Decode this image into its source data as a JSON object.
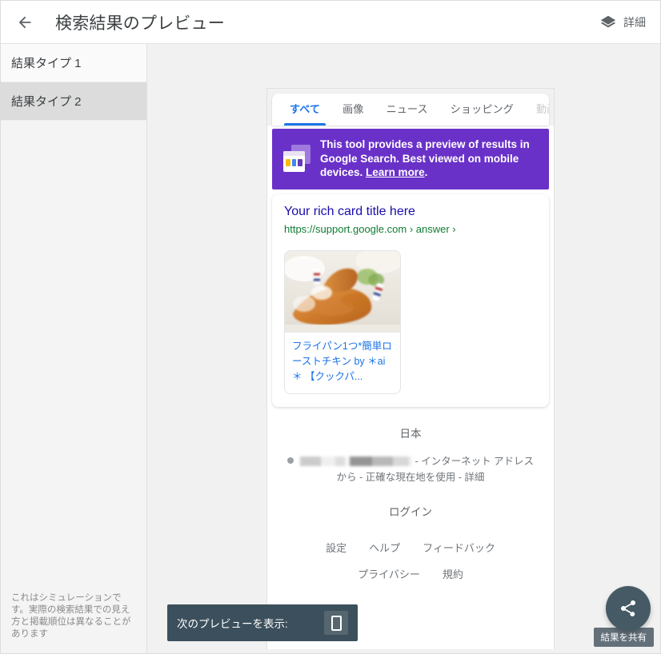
{
  "header": {
    "back_icon": "arrow-left-icon",
    "title": "検索結果のプレビュー",
    "details_icon": "layers-icon",
    "details_label": "詳細"
  },
  "sidebar": {
    "items": [
      {
        "label": "結果タイプ 1",
        "selected": false
      },
      {
        "label": "結果タイプ 2",
        "selected": true
      }
    ],
    "note": "これはシミュレーションです。実際の検索結果での見え方と掲載順位は異なることがあります"
  },
  "preview": {
    "tabs": [
      {
        "label": "すべて",
        "active": true
      },
      {
        "label": "画像",
        "active": false
      },
      {
        "label": "ニュース",
        "active": false
      },
      {
        "label": "ショッピング",
        "active": false
      },
      {
        "label": "動画",
        "active": false
      }
    ],
    "banner": {
      "icon": "browser-window-icon",
      "text_before": "This tool provides a preview of results in Google Search. Best viewed on mobile devices. ",
      "link_label": "Learn more",
      "text_after": ".",
      "background": "#6a31c9",
      "square_colors": [
        "#fbbc04",
        "#4285f4",
        "#673ab7"
      ]
    },
    "result": {
      "title": "Your rich card title here",
      "title_color": "#1a0dab",
      "url": "https://support.google.com › answer ›",
      "url_color": "#0f7c34",
      "rich_card": {
        "image_alt": "roast-chicken-photo",
        "caption": "フライパン1つ*簡単ローストチキン by ＊ai＊ 【クックパ...",
        "caption_color": "#1a73e8"
      }
    },
    "footer": {
      "country": "日本",
      "location_line_suffix": "- インターネット アドレスから - 正確な現在地を使用 - 詳細",
      "login": "ログイン",
      "links_row1": [
        "設定",
        "ヘルプ",
        "フィードバック"
      ],
      "links_row2": [
        "プライバシー",
        "規約"
      ]
    }
  },
  "next_preview": {
    "label": "次のプレビューを表示:",
    "device_icon": "mobile-phone-icon"
  },
  "share": {
    "icon": "share-icon",
    "tooltip": "結果を共有",
    "color": "#455a64"
  }
}
